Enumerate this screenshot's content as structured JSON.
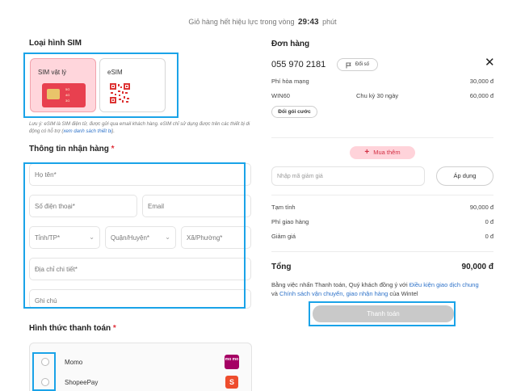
{
  "timer": {
    "prefix": "Giỏ hàng hết hiệu lực trong vòng",
    "time": "29:43",
    "suffix": "phút"
  },
  "sim_section": {
    "title": "Loại hình SIM",
    "options": [
      {
        "label": "SIM vật lý",
        "selected": true,
        "chip_text": [
          "5G",
          "4G",
          "3G"
        ]
      },
      {
        "label": "eSIM",
        "selected": false
      }
    ],
    "note_text": "Lưu ý: eSIM là SIM điện tử, được gửi qua email khách hàng. eSIM chỉ sử dụng được trên các thiết bị di động có hỗ trợ (",
    "note_link": "xem danh sách thiết bị",
    "note_end": ")."
  },
  "delivery": {
    "title": "Thông tin nhận hàng",
    "required_mark": "*",
    "fields": {
      "name": "Họ tên*",
      "phone": "Số điện thoại*",
      "email": "Email",
      "province": "Tỉnh/TP*",
      "district": "Quận/Huyện*",
      "ward": "Xã/Phường*",
      "address": "Địa chỉ chi tiết*",
      "note": "Ghi chú"
    },
    "chevron_icon": "chevron-down-icon"
  },
  "payment": {
    "title": "Hình thức thanh toán",
    "required_mark": "*",
    "methods": [
      {
        "label": "Momo",
        "logo_text": "mo mo"
      },
      {
        "label": "ShopeePay",
        "logo_text": "S"
      }
    ]
  },
  "order": {
    "title": "Đơn hàng",
    "phone_number": "055 970 2181",
    "change_number_label": "Đổi số",
    "close_icon": "close-icon",
    "lines": [
      {
        "label": "Phí hòa mạng",
        "middle": "",
        "amount": "30,000 đ"
      },
      {
        "label": "WIN60",
        "middle": "Chu kỳ 30 ngày",
        "amount": "60,000 đ"
      }
    ],
    "change_plan_label": "Đổi gói cước",
    "buy_more_label": "Mua thêm",
    "promo_placeholder": "Nhập mã giảm giá",
    "apply_label": "Áp dụng",
    "summary": [
      {
        "label": "Tạm tính",
        "value": "90,000 đ"
      },
      {
        "label": "Phí giao hàng",
        "value": "0 đ"
      },
      {
        "label": "Giảm giá",
        "value": "0 đ"
      }
    ],
    "total_label": "Tổng",
    "total_value": "90,000 đ",
    "terms_prefix": "Bằng việc nhấn Thanh toán, Quý khách đồng ý với",
    "terms_link1": "Điều kiện giao dịch chung",
    "terms_and": "và",
    "terms_link2": "Chính sách vận chuyển, giao nhận hàng",
    "terms_suffix": "của Wintel",
    "pay_label": "Thanh toán"
  },
  "colors": {
    "highlight": "#1aa3e8",
    "brand_red": "#e8404f",
    "link": "#2f73c9",
    "pay_disabled": "#c9c9c9"
  }
}
